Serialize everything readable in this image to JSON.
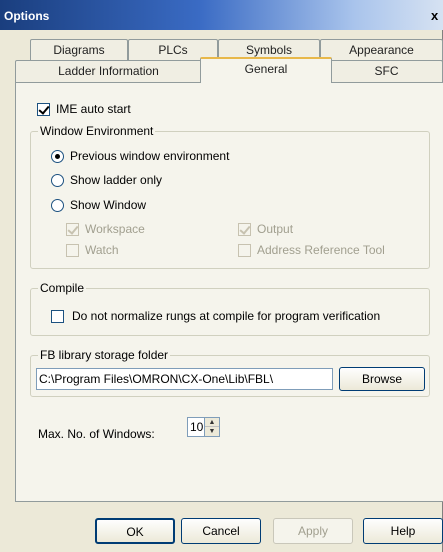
{
  "window": {
    "title": "Options",
    "close_glyph": "x"
  },
  "tabs": {
    "row1": [
      "Diagrams",
      "PLCs",
      "Symbols",
      "Appearance"
    ],
    "row2": [
      "Ladder Information",
      "General",
      "SFC"
    ],
    "selected": "General"
  },
  "ime": {
    "label": "IME auto start",
    "checked": true
  },
  "window_env": {
    "title": "Window Environment",
    "options": [
      "Previous window environment",
      "Show ladder only",
      "Show Window"
    ],
    "selected_option": "Previous window environment",
    "workspace": {
      "label": "Workspace",
      "checked": true,
      "enabled": false
    },
    "output": {
      "label": "Output",
      "checked": true,
      "enabled": false
    },
    "watch": {
      "label": "Watch",
      "checked": false,
      "enabled": false
    },
    "address_ref": {
      "label": "Address Reference Tool",
      "checked": false,
      "enabled": false
    }
  },
  "compile": {
    "title": "Compile",
    "option_label": "Do not normalize rungs at compile for program verification",
    "checked": false
  },
  "fb_library": {
    "title": "FB library storage folder",
    "path": "C:\\Program Files\\OMRON\\CX-One\\Lib\\FBL\\",
    "browse_label": "Browse"
  },
  "max_windows": {
    "label": "Max. No. of Windows:",
    "value": "10"
  },
  "buttons": {
    "ok": "OK",
    "cancel": "Cancel",
    "apply": "Apply",
    "help": "Help"
  }
}
